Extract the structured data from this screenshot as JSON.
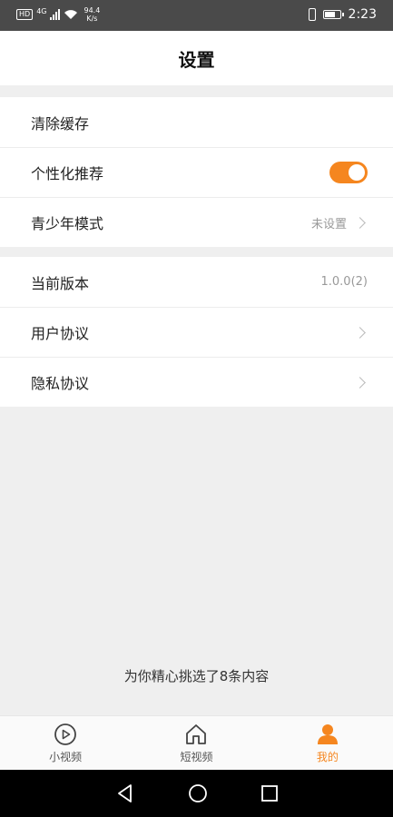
{
  "status_bar": {
    "hd": "HD",
    "signal_type": "4G",
    "net_speed_value": "94.4",
    "net_speed_unit": "K/s",
    "time": "2:23"
  },
  "header": {
    "title": "设置"
  },
  "settings_group_1": {
    "items": [
      {
        "label": "清除缓存"
      },
      {
        "label": "个性化推荐",
        "toggle_on": true
      },
      {
        "label": "青少年模式",
        "value": "未设置"
      }
    ]
  },
  "settings_group_2": {
    "items": [
      {
        "label": "当前版本",
        "value": "1.0.0(2)"
      },
      {
        "label": "用户协议"
      },
      {
        "label": "隐私协议"
      }
    ]
  },
  "footer": {
    "text": "为你精心挑选了8条内容"
  },
  "tab_bar": {
    "tabs": [
      {
        "label": "小视频",
        "icon": "play-circle-icon"
      },
      {
        "label": "短视频",
        "icon": "home-icon"
      },
      {
        "label": "我的",
        "icon": "user-icon",
        "active": true
      }
    ]
  },
  "colors": {
    "accent": "#f5861f",
    "background": "#efefef"
  }
}
